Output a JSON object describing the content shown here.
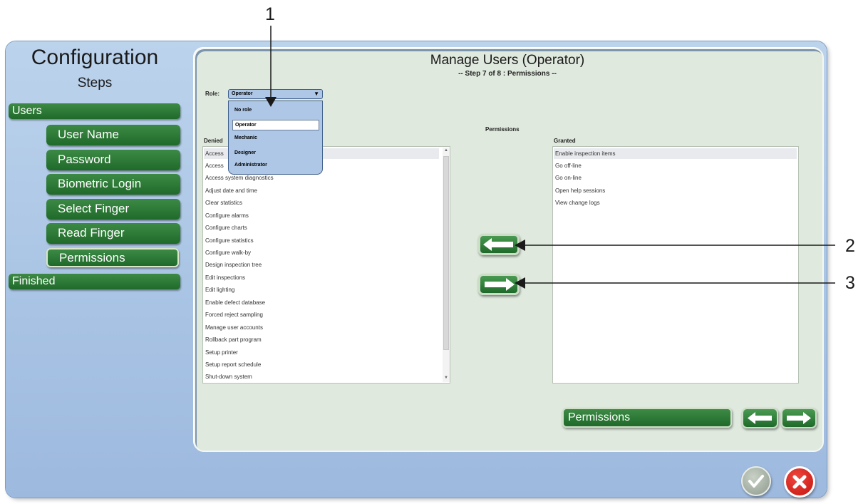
{
  "callouts": [
    "1",
    "2",
    "3"
  ],
  "sidebar": {
    "title": "Configuration",
    "subtitle": "Steps",
    "groups": {
      "users": "Users",
      "finished": "Finished"
    },
    "steps": [
      "User Name",
      "Password",
      "Biometric Login",
      "Select Finger",
      "Read Finger",
      "Permissions"
    ]
  },
  "main": {
    "title": "Manage Users (Operator)",
    "subtitle": "-- Step 7 of 8 : Permissions --",
    "role_label": "Role:",
    "role_value": "Operator",
    "role_options": [
      "No role",
      "Operator",
      "Mechanic",
      "Designer",
      "Administrator"
    ],
    "permissions_label": "Permissions",
    "denied_label": "Denied",
    "granted_label": "Granted",
    "denied_items": [
      "Access",
      "Access",
      "Access system diagnostics",
      "Adjust date and time",
      "Clear statistics",
      "Configure alarms",
      "Configure charts",
      "Configure statistics",
      "Configure walk-by",
      "Design inspection tree",
      "Edit inspections",
      "Edit lighting",
      "Enable defect database",
      "Forced reject sampling",
      "Manage user accounts",
      "Rollback part program",
      "Setup printer",
      "Setup report schedule",
      "Shut-down system"
    ],
    "granted_items": [
      "Enable inspection items",
      "Go off-line",
      "Go on-line",
      "Open help sessions",
      "View change logs"
    ],
    "step_indicator": "Permissions"
  },
  "colors": {
    "accent_green": "#1f6a2a",
    "window_blue": "#a9c4e4",
    "panel": "#dfe9dd",
    "cancel_red": "#cc1b14",
    "ok_gray": "#8e9a8c"
  }
}
